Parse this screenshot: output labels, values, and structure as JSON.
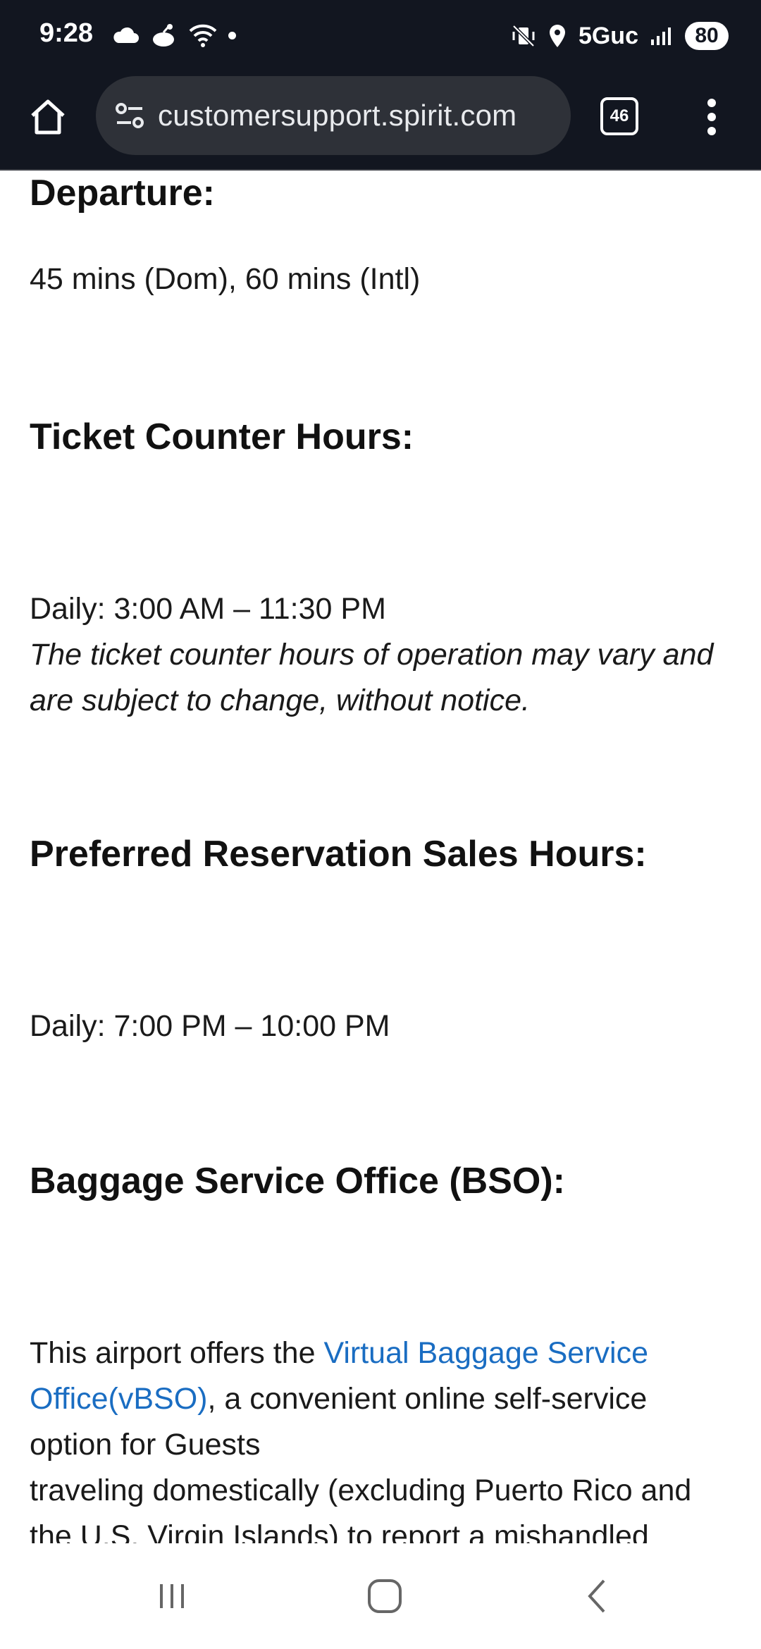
{
  "status_bar": {
    "time": "9:28",
    "network": "5Guc",
    "battery": "80"
  },
  "browser": {
    "url": "customersupport.spirit.com",
    "tab_count": "46"
  },
  "content": {
    "departure_heading": "Departure:",
    "departure_times": "45 mins (Dom), 60 mins (Intl)",
    "ticket_heading": "Ticket Counter Hours:",
    "ticket_hours": "Daily: 3:00 AM – 11:30 PM",
    "ticket_note_line1": "The ticket counter hours of operation may vary and",
    "ticket_note_line2": "are subject to change, without notice.",
    "preferred_heading": "Preferred Reservation Sales Hours:",
    "preferred_hours": "Daily: 7:00 PM – 10:00 PM",
    "bso_heading": "Baggage Service Office (BSO):",
    "bso_text_start": "This airport offers the ",
    "bso_link_line1": "Virtual Baggage Service",
    "bso_link_line2": "Office(vBSO)",
    "bso_text_line2_rest": ", a convenient online self-service",
    "bso_text_line3": "option for Guests",
    "bso_text_line4": "traveling domestically (excluding Puerto Rico and",
    "bso_text_line5": "the U.S. Virgin Islands) to report a mishandled"
  },
  "colors": {
    "chrome_bg": "#121620",
    "link": "#1a6dc2"
  }
}
